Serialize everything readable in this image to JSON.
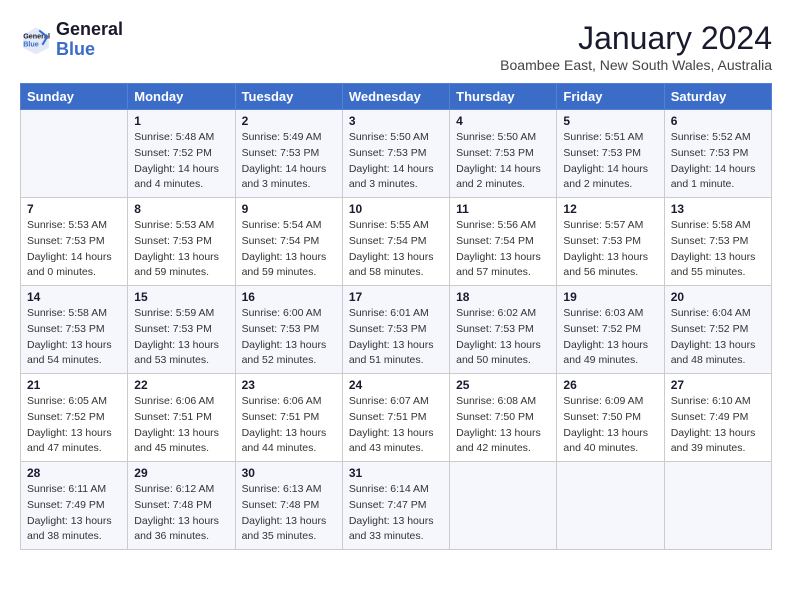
{
  "header": {
    "logo_line1": "General",
    "logo_line2": "Blue",
    "month": "January 2024",
    "location": "Boambee East, New South Wales, Australia"
  },
  "weekdays": [
    "Sunday",
    "Monday",
    "Tuesday",
    "Wednesday",
    "Thursday",
    "Friday",
    "Saturday"
  ],
  "weeks": [
    [
      {
        "day": "",
        "info": ""
      },
      {
        "day": "1",
        "info": "Sunrise: 5:48 AM\nSunset: 7:52 PM\nDaylight: 14 hours\nand 4 minutes."
      },
      {
        "day": "2",
        "info": "Sunrise: 5:49 AM\nSunset: 7:53 PM\nDaylight: 14 hours\nand 3 minutes."
      },
      {
        "day": "3",
        "info": "Sunrise: 5:50 AM\nSunset: 7:53 PM\nDaylight: 14 hours\nand 3 minutes."
      },
      {
        "day": "4",
        "info": "Sunrise: 5:50 AM\nSunset: 7:53 PM\nDaylight: 14 hours\nand 2 minutes."
      },
      {
        "day": "5",
        "info": "Sunrise: 5:51 AM\nSunset: 7:53 PM\nDaylight: 14 hours\nand 2 minutes."
      },
      {
        "day": "6",
        "info": "Sunrise: 5:52 AM\nSunset: 7:53 PM\nDaylight: 14 hours\nand 1 minute."
      }
    ],
    [
      {
        "day": "7",
        "info": "Sunrise: 5:53 AM\nSunset: 7:53 PM\nDaylight: 14 hours\nand 0 minutes."
      },
      {
        "day": "8",
        "info": "Sunrise: 5:53 AM\nSunset: 7:53 PM\nDaylight: 13 hours\nand 59 minutes."
      },
      {
        "day": "9",
        "info": "Sunrise: 5:54 AM\nSunset: 7:54 PM\nDaylight: 13 hours\nand 59 minutes."
      },
      {
        "day": "10",
        "info": "Sunrise: 5:55 AM\nSunset: 7:54 PM\nDaylight: 13 hours\nand 58 minutes."
      },
      {
        "day": "11",
        "info": "Sunrise: 5:56 AM\nSunset: 7:54 PM\nDaylight: 13 hours\nand 57 minutes."
      },
      {
        "day": "12",
        "info": "Sunrise: 5:57 AM\nSunset: 7:53 PM\nDaylight: 13 hours\nand 56 minutes."
      },
      {
        "day": "13",
        "info": "Sunrise: 5:58 AM\nSunset: 7:53 PM\nDaylight: 13 hours\nand 55 minutes."
      }
    ],
    [
      {
        "day": "14",
        "info": "Sunrise: 5:58 AM\nSunset: 7:53 PM\nDaylight: 13 hours\nand 54 minutes."
      },
      {
        "day": "15",
        "info": "Sunrise: 5:59 AM\nSunset: 7:53 PM\nDaylight: 13 hours\nand 53 minutes."
      },
      {
        "day": "16",
        "info": "Sunrise: 6:00 AM\nSunset: 7:53 PM\nDaylight: 13 hours\nand 52 minutes."
      },
      {
        "day": "17",
        "info": "Sunrise: 6:01 AM\nSunset: 7:53 PM\nDaylight: 13 hours\nand 51 minutes."
      },
      {
        "day": "18",
        "info": "Sunrise: 6:02 AM\nSunset: 7:53 PM\nDaylight: 13 hours\nand 50 minutes."
      },
      {
        "day": "19",
        "info": "Sunrise: 6:03 AM\nSunset: 7:52 PM\nDaylight: 13 hours\nand 49 minutes."
      },
      {
        "day": "20",
        "info": "Sunrise: 6:04 AM\nSunset: 7:52 PM\nDaylight: 13 hours\nand 48 minutes."
      }
    ],
    [
      {
        "day": "21",
        "info": "Sunrise: 6:05 AM\nSunset: 7:52 PM\nDaylight: 13 hours\nand 47 minutes."
      },
      {
        "day": "22",
        "info": "Sunrise: 6:06 AM\nSunset: 7:51 PM\nDaylight: 13 hours\nand 45 minutes."
      },
      {
        "day": "23",
        "info": "Sunrise: 6:06 AM\nSunset: 7:51 PM\nDaylight: 13 hours\nand 44 minutes."
      },
      {
        "day": "24",
        "info": "Sunrise: 6:07 AM\nSunset: 7:51 PM\nDaylight: 13 hours\nand 43 minutes."
      },
      {
        "day": "25",
        "info": "Sunrise: 6:08 AM\nSunset: 7:50 PM\nDaylight: 13 hours\nand 42 minutes."
      },
      {
        "day": "26",
        "info": "Sunrise: 6:09 AM\nSunset: 7:50 PM\nDaylight: 13 hours\nand 40 minutes."
      },
      {
        "day": "27",
        "info": "Sunrise: 6:10 AM\nSunset: 7:49 PM\nDaylight: 13 hours\nand 39 minutes."
      }
    ],
    [
      {
        "day": "28",
        "info": "Sunrise: 6:11 AM\nSunset: 7:49 PM\nDaylight: 13 hours\nand 38 minutes."
      },
      {
        "day": "29",
        "info": "Sunrise: 6:12 AM\nSunset: 7:48 PM\nDaylight: 13 hours\nand 36 minutes."
      },
      {
        "day": "30",
        "info": "Sunrise: 6:13 AM\nSunset: 7:48 PM\nDaylight: 13 hours\nand 35 minutes."
      },
      {
        "day": "31",
        "info": "Sunrise: 6:14 AM\nSunset: 7:47 PM\nDaylight: 13 hours\nand 33 minutes."
      },
      {
        "day": "",
        "info": ""
      },
      {
        "day": "",
        "info": ""
      },
      {
        "day": "",
        "info": ""
      }
    ]
  ]
}
